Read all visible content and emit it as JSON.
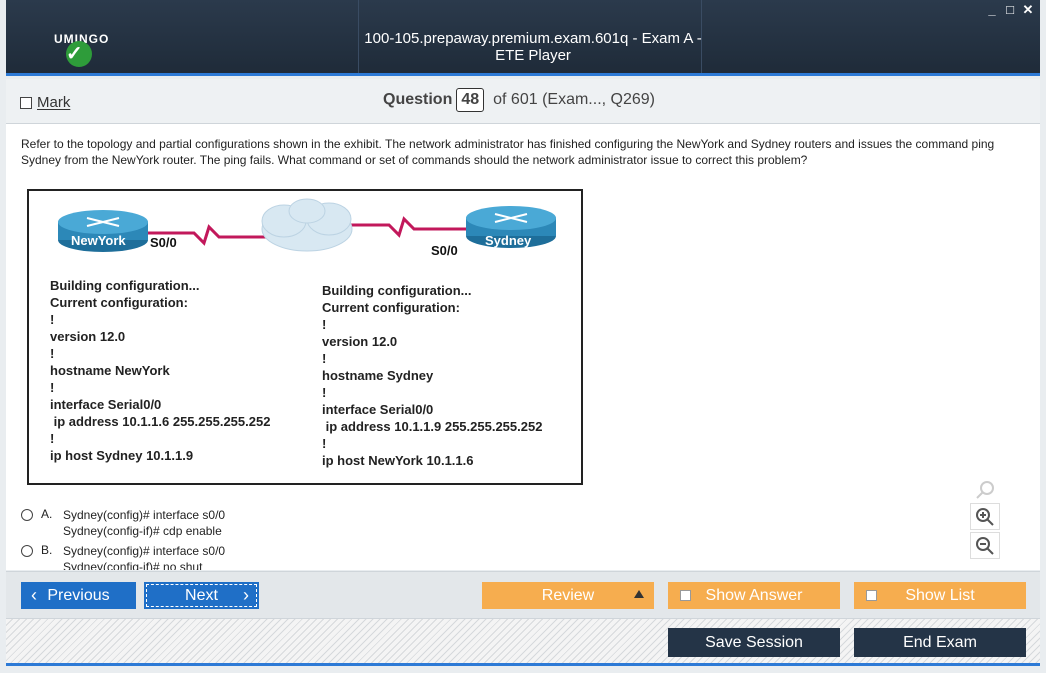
{
  "window": {
    "title": "100-105.prepaway.premium.exam.601q - Exam A - ETE Player",
    "logo_text": "UMINGO",
    "controls": [
      "_",
      "□",
      "✕"
    ]
  },
  "question_header": {
    "mark_label": "Mark",
    "question_label": "Question",
    "question_number": "48",
    "of_text": "of 601 (Exam..., Q269)"
  },
  "question": {
    "text": "Refer to the topology and partial configurations shown in the exhibit. The network administrator has finished configuring the NewYork and Sydney routers and issues the command ping Sydney from the NewYork router. The ping fails. What command or set of commands should the network administrator issue to correct this problem?"
  },
  "exhibit": {
    "router_left": "NewYork",
    "router_right": "Sydney",
    "left_interface": "S0/0",
    "right_interface": "S0/0",
    "left_config": "Building configuration...\nCurrent configuration:\n!\nversion 12.0\n!\nhostname NewYork\n!\ninterface Serial0/0\n ip address 10.1.1.6 255.255.255.252\n!\nip host Sydney 10.1.1.9",
    "right_config": "Building configuration...\nCurrent configuration:\n!\nversion 12.0\n!\nhostname Sydney\n!\ninterface Serial0/0\n ip address 10.1.1.9 255.255.255.252\n!\nip host NewYork 10.1.1.6"
  },
  "options": [
    {
      "letter": "A.",
      "line1": "Sydney(config)# interface s0/0",
      "line2": "Sydney(config-if)# cdp enable"
    },
    {
      "letter": "B.",
      "line1": "Sydney(config)# interface s0/0",
      "line2": "Sydney(config-if)# no shut"
    }
  ],
  "nav": {
    "previous": "Previous",
    "next": "Next",
    "review": "Review",
    "show_answer": "Show Answer",
    "show_list": "Show List"
  },
  "bottom": {
    "save_session": "Save Session",
    "end_exam": "End Exam"
  }
}
